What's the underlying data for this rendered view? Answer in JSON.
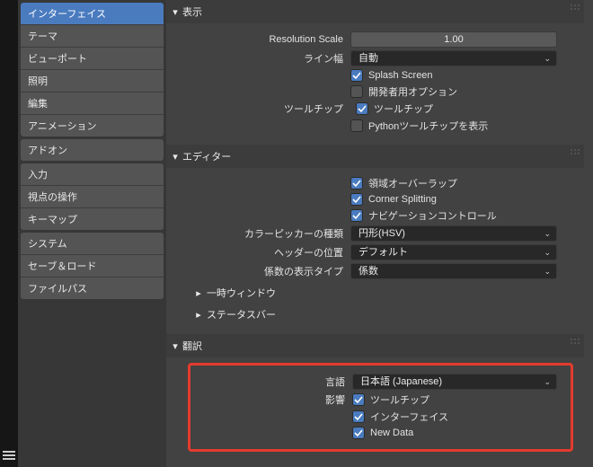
{
  "sidebar": {
    "groups": [
      {
        "items": [
          {
            "label": "インターフェイス",
            "active": true
          },
          {
            "label": "テーマ"
          },
          {
            "label": "ビューポート"
          },
          {
            "label": "照明"
          },
          {
            "label": "編集"
          },
          {
            "label": "アニメーション"
          }
        ]
      },
      {
        "items": [
          {
            "label": "アドオン"
          }
        ]
      },
      {
        "items": [
          {
            "label": "入力"
          },
          {
            "label": "視点の操作"
          },
          {
            "label": "キーマップ"
          }
        ]
      },
      {
        "items": [
          {
            "label": "システム"
          },
          {
            "label": "セーブ＆ロード"
          },
          {
            "label": "ファイルパス"
          }
        ]
      }
    ]
  },
  "display": {
    "title": "表示",
    "resolution_label": "Resolution Scale",
    "resolution_value": "1.00",
    "line_width_label": "ライン幅",
    "line_width_value": "自動",
    "splash_label": "Splash Screen",
    "splash_on": true,
    "dev_label": "開発者用オプション",
    "dev_on": false,
    "tooltip_section_label": "ツールチップ",
    "tooltip_label": "ツールチップ",
    "tooltip_on": true,
    "python_tip_label": "Pythonツールチップを表示",
    "python_tip_on": false
  },
  "editor": {
    "title": "エディター",
    "region_overlap": "領域オーバーラップ",
    "region_overlap_on": true,
    "corner_split": "Corner Splitting",
    "corner_split_on": true,
    "nav_controls": "ナビゲーションコントロール",
    "nav_controls_on": true,
    "color_picker_label": "カラーピッカーの種類",
    "color_picker_value": "円形(HSV)",
    "header_pos_label": "ヘッダーの位置",
    "header_pos_value": "デフォルト",
    "factor_label": "係数の表示タイプ",
    "factor_value": "係数",
    "temp_window": "一時ウィンドウ",
    "status_bar": "ステータスバー"
  },
  "translation": {
    "title": "翻訳",
    "lang_label": "言語",
    "lang_value": "日本語 (Japanese)",
    "affect_label": "影響",
    "tooltip": "ツールチップ",
    "tooltip_on": true,
    "interface": "インターフェイス",
    "interface_on": true,
    "newdata": "New Data",
    "newdata_on": true
  }
}
